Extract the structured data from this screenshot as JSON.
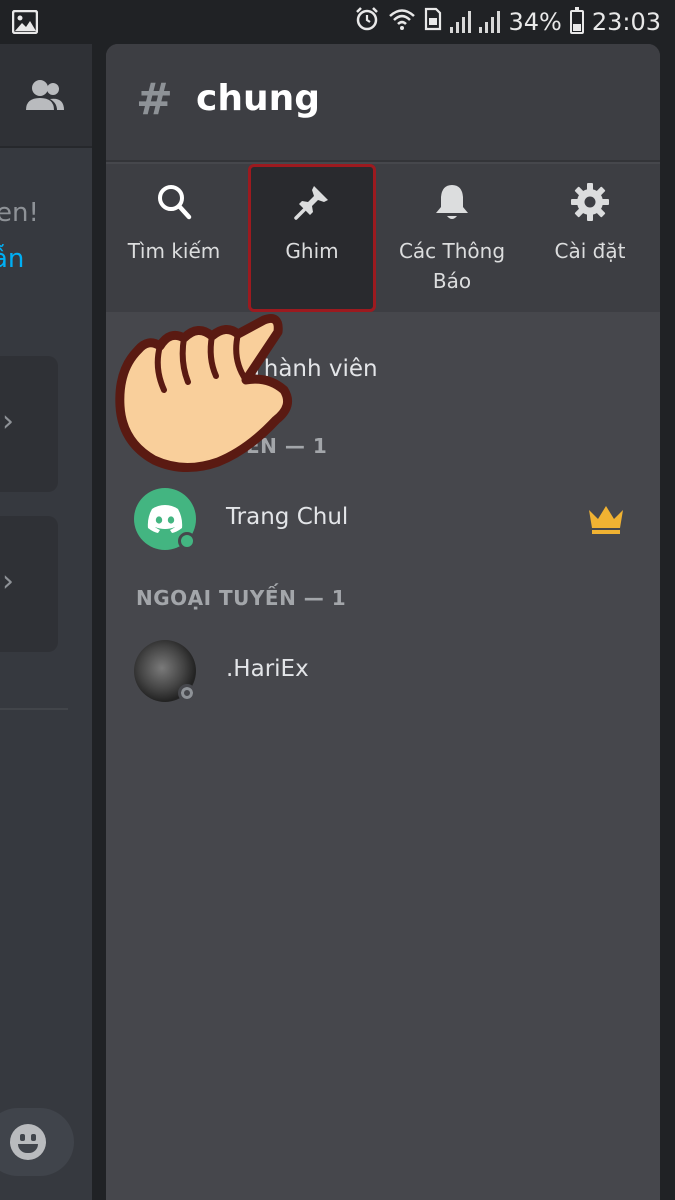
{
  "status_bar": {
    "battery": "34%",
    "time": "23:03",
    "icons": [
      "image-icon",
      "alarm-icon",
      "wifi-icon",
      "sim-icon",
      "signal-icon",
      "signal-icon",
      "battery-icon"
    ]
  },
  "left_panel": {
    "text_partial_1": "en!",
    "text_partial_2": "ẫn",
    "icons": [
      "members-icon",
      "chevron-right-icon",
      "chevron-right-icon",
      "emoji-icon"
    ]
  },
  "channel": {
    "hash": "#",
    "name": "chung"
  },
  "toolbar": {
    "items": [
      {
        "label": "Tìm kiếm",
        "icon": "search-icon"
      },
      {
        "label": "Ghim",
        "icon": "pin-icon",
        "active": true
      },
      {
        "label": "Các Thông\nBáo",
        "icon": "bell-icon"
      },
      {
        "label": "Cài đặt",
        "icon": "gear-icon"
      }
    ]
  },
  "members_panel": {
    "invite_label": "i Thành viên",
    "online_header": "ẾN — 1",
    "offline_header": "NGOẠI TUYẾN — 1",
    "members": [
      {
        "name": "Trang Chul",
        "status": "online",
        "owner": true,
        "avatar": "discord-logo-icon"
      },
      {
        "name": ".HariEx",
        "status": "offline",
        "owner": false,
        "avatar": "photo"
      }
    ]
  },
  "colors": {
    "accent_red": "#9c1a1f",
    "online_green": "#43b581",
    "crown_gold": "#f0b232",
    "link_blue": "#00aff4"
  }
}
